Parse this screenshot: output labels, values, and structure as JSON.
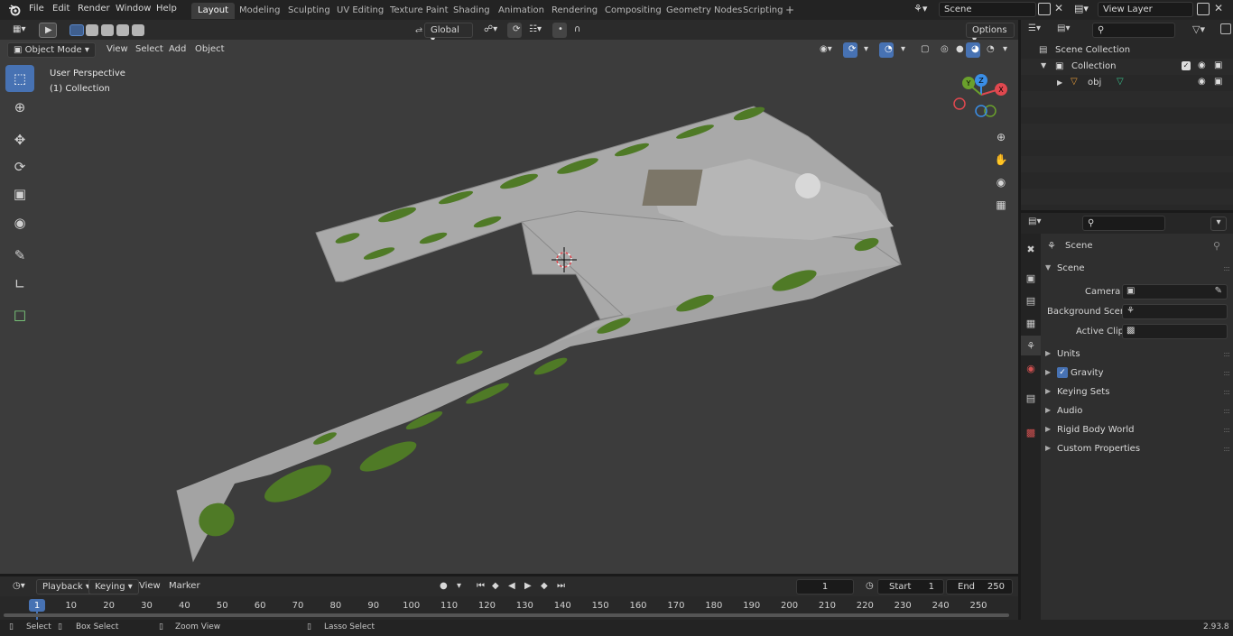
{
  "top_menu": {
    "items": [
      "File",
      "Edit",
      "Render",
      "Window",
      "Help"
    ]
  },
  "workspaces": {
    "tabs": [
      "Layout",
      "Modeling",
      "Sculpting",
      "UV Editing",
      "Texture Paint",
      "Shading",
      "Animation",
      "Rendering",
      "Compositing",
      "Geometry Nodes",
      "Scripting"
    ],
    "active": "Layout",
    "add_tab": "+"
  },
  "scene_selector": {
    "value": "Scene"
  },
  "view_layer_selector": {
    "value": "View Layer"
  },
  "tool_header": {
    "transform_orientation": "Global",
    "options_label": "Options"
  },
  "viewport_header": {
    "mode": "Object Mode",
    "menus": [
      "View",
      "Select",
      "Add",
      "Object"
    ]
  },
  "viewport": {
    "perspective_label": "User Perspective",
    "collection_label": "(1) Collection",
    "gizmo": {
      "x": "X",
      "y": "Y",
      "z": "Z"
    }
  },
  "outliner": {
    "search_placeholder": "",
    "rows": [
      {
        "label": "Scene Collection"
      },
      {
        "label": "Collection"
      },
      {
        "label": "obj"
      }
    ]
  },
  "properties": {
    "context_label": "Scene",
    "section_title": "Scene",
    "camera_label": "Camera",
    "background_scene_label": "Background Scene",
    "active_clip_label": "Active Clip",
    "panels": [
      "Units",
      "Gravity",
      "Keying Sets",
      "Audio",
      "Rigid Body World",
      "Custom Properties"
    ]
  },
  "timeline": {
    "menus": [
      "Playback",
      "Keying",
      "View",
      "Marker"
    ],
    "current_frame": "1",
    "start_label": "Start",
    "start_value": "1",
    "end_label": "End",
    "end_value": "250",
    "frame_numbers": [
      "1",
      "10",
      "20",
      "30",
      "40",
      "50",
      "60",
      "70",
      "80",
      "90",
      "100",
      "110",
      "120",
      "130",
      "140",
      "150",
      "160",
      "170",
      "180",
      "190",
      "200",
      "210",
      "220",
      "230",
      "240",
      "250"
    ]
  },
  "status_bar": {
    "items": [
      "Select",
      "Box Select",
      "Zoom View",
      "Lasso Select"
    ],
    "version": "2.93.8"
  },
  "colors": {
    "accent": "#4772b3",
    "viewport_bg": "#3c3c3c",
    "mesh_grey": "#a8a8a8",
    "grass_green": "#4f7a26",
    "axis_x": "#e0484f",
    "axis_y": "#6aa02c",
    "axis_z": "#3a8ee6"
  }
}
